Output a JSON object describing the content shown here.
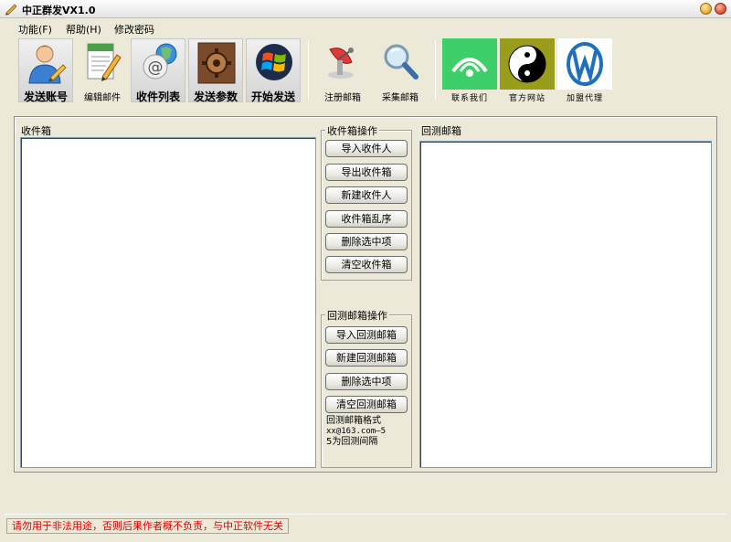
{
  "window": {
    "title": "中正群发VX1.0"
  },
  "menu": [
    "功能(F)",
    "帮助(H)",
    "修改密码"
  ],
  "toolbar": {
    "buttons": [
      {
        "label": "发送账号",
        "icon": "user-edit-icon"
      },
      {
        "label": "编辑邮件",
        "icon": "document-edit-icon"
      },
      {
        "label": "收件列表",
        "icon": "email-address-icon"
      },
      {
        "label": "发送参数",
        "icon": "settings-gear-icon"
      },
      {
        "label": "开始发送",
        "icon": "windows-logo-icon"
      },
      {
        "label": "注册邮箱",
        "icon": "satellite-dish-icon"
      },
      {
        "label": "采集邮箱",
        "icon": "magnifier-icon"
      }
    ],
    "tiles": [
      {
        "label": "联系我们",
        "icon": "contact-dish-icon",
        "color": "#3ecf6a"
      },
      {
        "label": "官方网站",
        "icon": "yin-yang-icon",
        "color": "#9a9d1c"
      },
      {
        "label": "加盟代理",
        "icon": "w-logo-icon",
        "color": "#1f6fbf"
      }
    ]
  },
  "inbox": {
    "label": "收件箱"
  },
  "inbox_ops": {
    "title": "收件箱操作",
    "buttons": [
      "导入收件人",
      "导出收件箱",
      "新建收件人",
      "收件箱乱序",
      "删除选中项",
      "清空收件箱"
    ]
  },
  "test_ops": {
    "title": "回测邮箱操作",
    "buttons": [
      "导入回测邮箱",
      "新建回测邮箱",
      "删除选中项",
      "清空回测邮箱"
    ],
    "format_title": "回测邮箱格式",
    "format_example": "xx@163.com—5",
    "format_note": "5为回测间隔"
  },
  "test_inbox": {
    "label": "回测邮箱"
  },
  "status": {
    "text": "请勿用于非法用途，否则后果作者概不负责，与中正软件无关",
    "color": "#e00000"
  }
}
